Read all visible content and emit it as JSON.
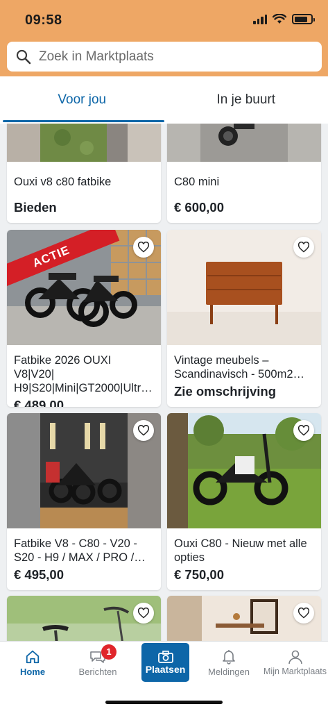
{
  "status_bar": {
    "time": "09:58"
  },
  "search": {
    "placeholder": "Zoek in Marktplaats"
  },
  "tabs": [
    {
      "label": "Voor jou",
      "active": true
    },
    {
      "label": "In je buurt",
      "active": false
    }
  ],
  "listings": [
    {
      "title": "Ouxi v8 c80 fatbike",
      "price": "Bieden"
    },
    {
      "title": "C80 mini",
      "price": "€ 600,00"
    },
    {
      "title": "Fatbike 2026 OUXI V8|V20| H9|S20|Mini|GT2000|Ultr…",
      "price": "€ 489,00",
      "ribbon": "ACTIE"
    },
    {
      "title": "Vintage meubels – Scandinavisch - 500m2…",
      "price": "Zie omschrijving"
    },
    {
      "title": "Fatbike V8 - C80 - V20 - S20 - H9 / MAX / PRO /…",
      "price": "€ 495,00"
    },
    {
      "title": "Ouxi C80 - Nieuw met alle opties",
      "price": "€ 750,00"
    }
  ],
  "bottom_nav": {
    "items": [
      {
        "label": "Home",
        "icon": "home-icon",
        "active": true
      },
      {
        "label": "Berichten",
        "icon": "chat-icon",
        "badge": "1"
      },
      {
        "label": "Plaatsen",
        "icon": "camera-icon"
      },
      {
        "label": "Meldingen",
        "icon": "bell-icon"
      },
      {
        "label": "Mijn Marktplaats",
        "icon": "user-icon"
      }
    ]
  },
  "colors": {
    "header": "#eea765",
    "accent": "#0d66a8",
    "badge": "#e0262b",
    "ribbon": "#d41f26"
  }
}
